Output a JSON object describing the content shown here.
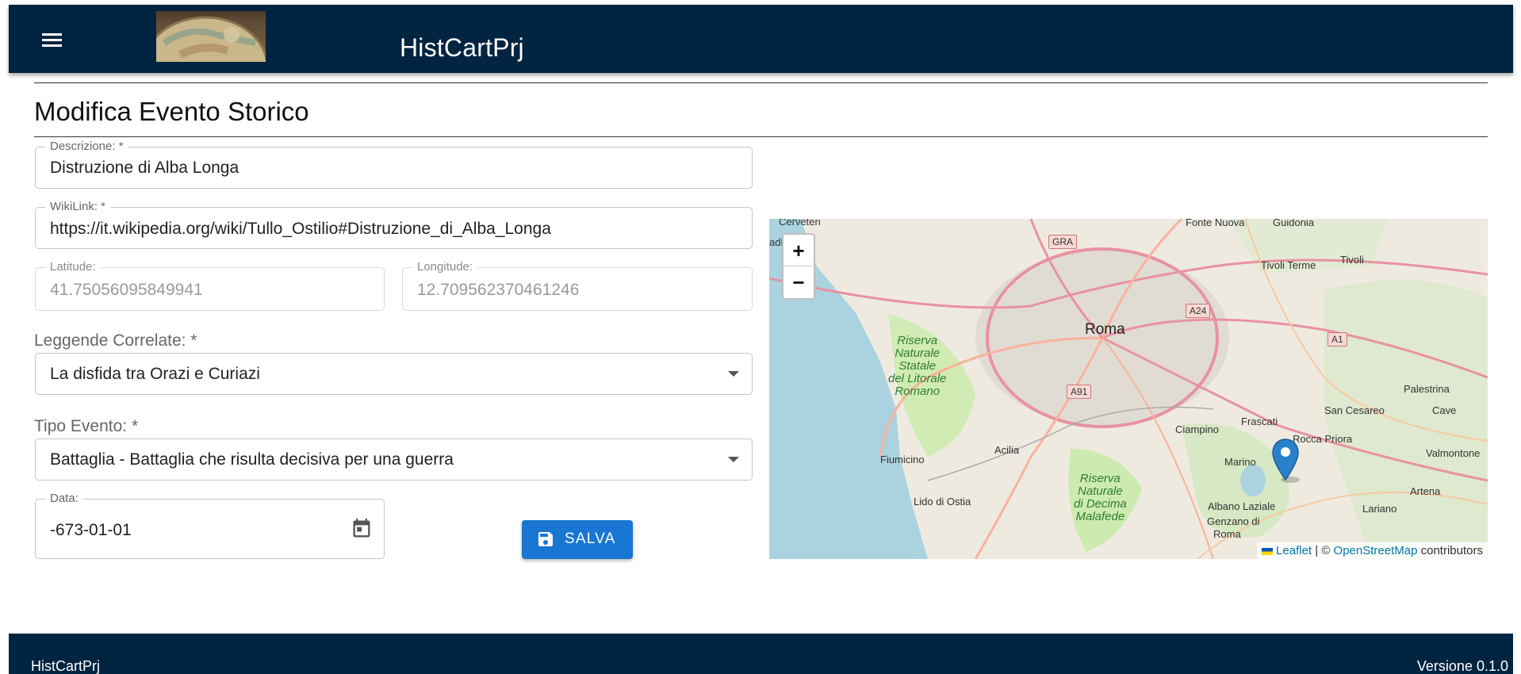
{
  "header": {
    "title": "HistCartPrj",
    "menu_icon": "menu-icon",
    "logo_icon": "globe-logo"
  },
  "page": {
    "title": "Modifica Evento Storico"
  },
  "form": {
    "descrizione": {
      "label": "Descrizione: *",
      "value": "Distruzione di Alba Longa"
    },
    "wikilink": {
      "label": "WikiLink: *",
      "value": "https://it.wikipedia.org/wiki/Tullo_Ostilio#Distruzione_di_Alba_Longa"
    },
    "latitude": {
      "label": "Latitude:",
      "value": "41.75056095849941"
    },
    "longitude": {
      "label": "Longitude:",
      "value": "12.709562370461246"
    },
    "leggende": {
      "label": "Leggende Correlate: *",
      "value": "La disfida tra Orazi e Curiazi"
    },
    "tipo_evento": {
      "label": "Tipo Evento: *",
      "value": "Battaglia - Battaglia che risulta decisiva per una guerra"
    },
    "data": {
      "label": "Data:",
      "value": "-673-01-01",
      "icon": "calendar-icon"
    },
    "save_label": "SALVA",
    "save_icon": "floppy-disk-icon"
  },
  "map": {
    "zoom_in": "+",
    "zoom_out": "−",
    "attribution": {
      "leaflet": "Leaflet",
      "separator": " | © ",
      "osm": "OpenStreetMap",
      "suffix": " contributors"
    },
    "places": {
      "roma": "Roma",
      "cerveteri": "Cerveteri",
      "fonte_nuova": "Fonte Nuova",
      "guidonia": "Guidonia",
      "tivoli_terme": "Tivoli Terme",
      "tivoli": "Tivoli",
      "fiumicino": "Fiumicino",
      "acilia": "Acilia",
      "lido_di_ostia": "Lido di Ostia",
      "ciampino": "Ciampino",
      "frascati": "Frascati",
      "marino": "Marino",
      "albano_laziale": "Albano Laziale",
      "genzano": "Genzano di",
      "genzano2": "Roma",
      "lariano": "Lariano",
      "artena": "Artena",
      "rocca_priora": "Rocca Priora",
      "san_cesareo": "San Cesareo",
      "palestrina": "Palestrina",
      "cave": "Cave",
      "valmontone": "Valmontone",
      "ladi": "adi",
      "riserva1": "Riserva\nNaturale\nStatale\ndel Litorale\nRomano",
      "riserva2": "Riserva\nNaturale\ndi Decima\nMalafede"
    },
    "roads": {
      "gra": "GRA",
      "a24": "A24",
      "a1": "A1",
      "a91": "A91"
    },
    "marker_icon": "map-pin-icon"
  },
  "footer": {
    "left": "HistCartPrj",
    "right": "Versione 0.1.0"
  }
}
